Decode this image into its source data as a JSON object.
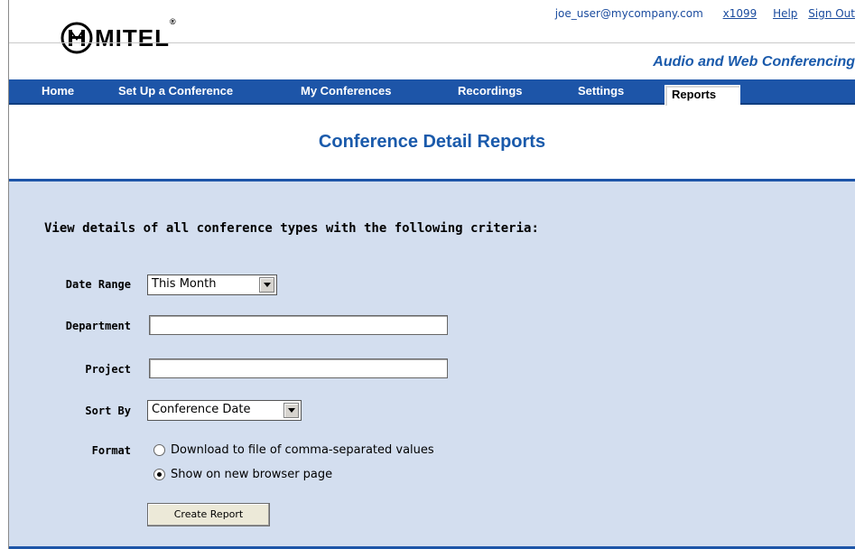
{
  "header": {
    "logo_text": "MITEL",
    "logo_mark": "®",
    "user_email": "joe_user@mycompany.com",
    "extension": "x1099",
    "help_label": "Help",
    "signout_label": "Sign Out",
    "product_name": "Audio and Web Conferencing"
  },
  "nav": {
    "items": [
      {
        "label": "Home"
      },
      {
        "label": "Set Up a Conference"
      },
      {
        "label": "My Conferences"
      },
      {
        "label": "Recordings"
      },
      {
        "label": "Settings"
      },
      {
        "label": "Reports"
      }
    ],
    "active": "Reports"
  },
  "page": {
    "title": "Conference Detail Reports",
    "criteria_text": "View details of all conference types with the following criteria:"
  },
  "form": {
    "date_range_label": "Date Range",
    "date_range_value": "This Month",
    "department_label": "Department",
    "department_value": "",
    "project_label": "Project",
    "project_value": "",
    "sort_by_label": "Sort By",
    "sort_by_value": "Conference Date",
    "format_label": "Format",
    "format_options": [
      {
        "label": "Download to file of comma-separated values",
        "selected": false
      },
      {
        "label": "Show on new browser page",
        "selected": true
      }
    ],
    "create_button": "Create Report"
  },
  "colors": {
    "nav_bg": "#1d55a8",
    "panel_bg": "#d3deef",
    "title_color": "#1a5aab",
    "link_color": "#1a4b9e"
  }
}
